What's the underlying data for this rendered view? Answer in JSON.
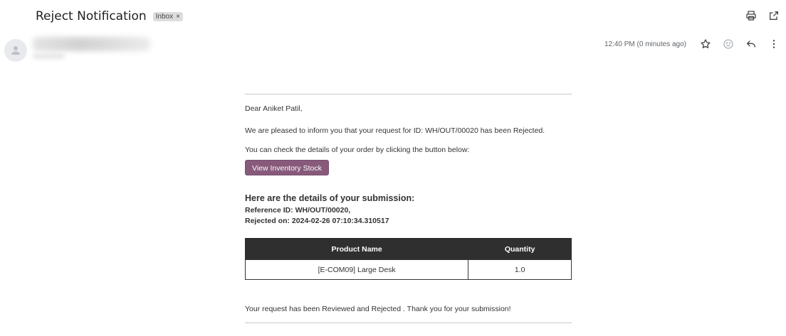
{
  "email": {
    "subject": "Reject Notification",
    "label": "Inbox",
    "label_remove": "×",
    "timestamp": "12:40 PM (0 minutes ago)"
  },
  "icons": {
    "print": "print-icon",
    "open_new_window": "open-in-new-window-icon",
    "star": "star-icon",
    "emoji": "emoji-icon",
    "reply": "reply-icon",
    "more": "more-vertical-icon",
    "avatar": "person-icon"
  },
  "body": {
    "greeting": "Dear Aniket Patil,",
    "message": "We are pleased to inform you that your request for ID: WH/OUT/00020 has been Rejected.",
    "instruction": "You can check the details of your order by clicking the button below:",
    "button_label": "View Inventory Stock",
    "button_color": "#875a7b",
    "details_title": "Here are the details of your submission:",
    "reference_line": "Reference ID: WH/OUT/00020,",
    "rejected_line": "Rejected on: 2024-02-26 07:10:34.310517",
    "table": {
      "headers": [
        "Product Name",
        "Quantity"
      ],
      "rows": [
        [
          "[E-COM09] Large Desk",
          "1.0"
        ]
      ]
    },
    "closing": "Your request has been Reviewed and Rejected . Thank you for your submission!"
  }
}
